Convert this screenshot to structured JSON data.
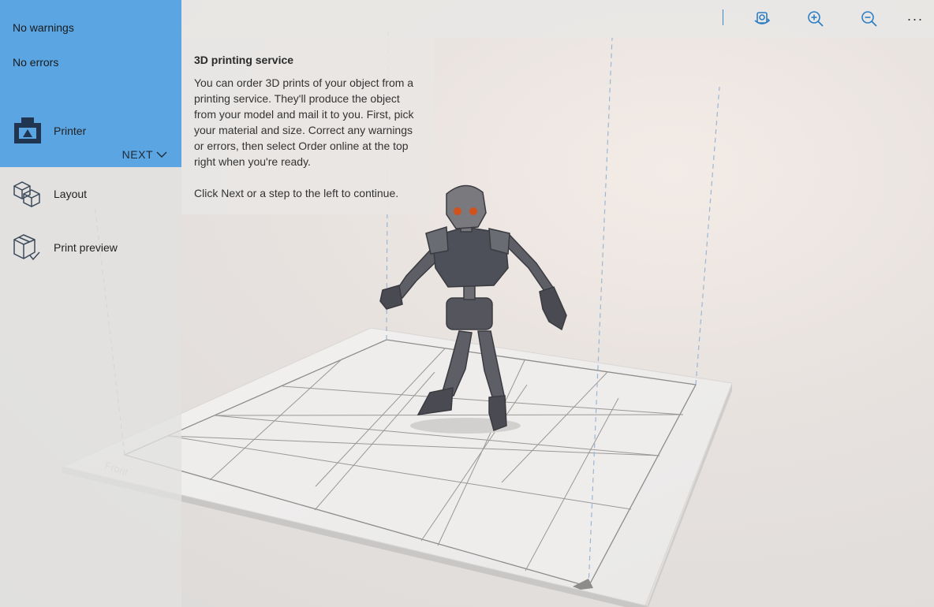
{
  "status": {
    "warnings": "No warnings",
    "errors": "No errors"
  },
  "steps": [
    {
      "label": "Printer",
      "icon": "printer-icon"
    },
    {
      "label": "Layout",
      "icon": "layout-cubes-icon"
    },
    {
      "label": "Print preview",
      "icon": "print-preview-icon"
    }
  ],
  "next_label": "NEXT",
  "info": {
    "title": "3D printing service",
    "body": "You can order 3D prints of your object from a printing service. They'll produce the object from your model and mail it to you. First, pick your material and size. Correct any warnings or errors, then select Order online at the top right when you're ready.",
    "continue": "Click Next or a step to the left to continue."
  },
  "toolbar": {
    "more": "···"
  },
  "build_plate": {
    "front_label": "Front"
  },
  "colors": {
    "accent": "#5ba5e3",
    "separator": "#3d88c9"
  }
}
